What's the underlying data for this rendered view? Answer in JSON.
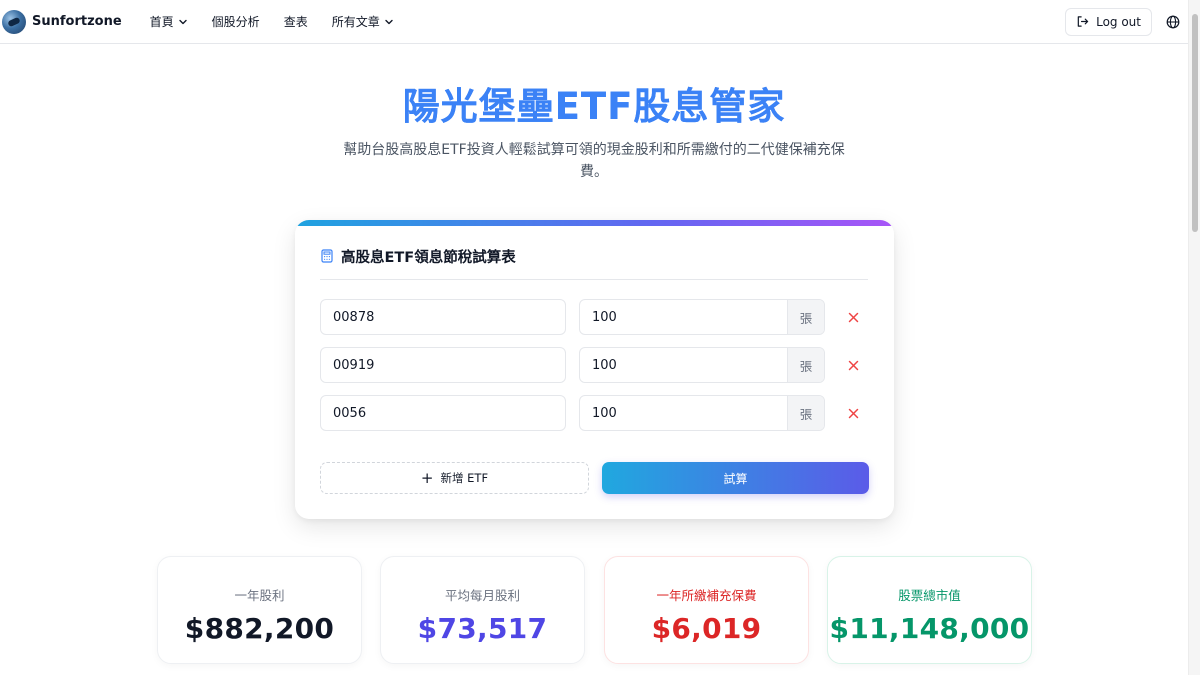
{
  "nav": {
    "brand": "Sunfortzone",
    "items": [
      {
        "label": "首頁",
        "has_dropdown": true
      },
      {
        "label": "個股分析",
        "has_dropdown": false
      },
      {
        "label": "查表",
        "has_dropdown": false
      },
      {
        "label": "所有文章",
        "has_dropdown": true
      }
    ],
    "logout_label": "Log out"
  },
  "hero": {
    "title": "陽光堡壘ETF股息管家",
    "subtitle": "幫助台股高股息ETF投資人輕鬆試算可領的現金股利和所需繳付的二代健保補充保費。"
  },
  "calculator": {
    "title": "高股息ETF領息節稅試算表",
    "unit": "張",
    "rows": [
      {
        "code": "00878",
        "quantity": "100"
      },
      {
        "code": "00919",
        "quantity": "100"
      },
      {
        "code": "0056",
        "quantity": "100"
      }
    ],
    "add_label": "新增 ETF",
    "calc_label": "試算"
  },
  "stats": [
    {
      "label": "一年股利",
      "value": "$882,200",
      "color": "#111827",
      "label_color": "#6b7280"
    },
    {
      "label": "平均每月股利",
      "value": "$73,517",
      "color": "#4f46e5",
      "label_color": "#6b7280"
    },
    {
      "label": "一年所繳補充保費",
      "value": "$6,019",
      "color": "#dc2626",
      "label_color": "#dc2626"
    },
    {
      "label": "股票總市值",
      "value": "$11,148,000",
      "color": "#059669",
      "label_color": "#059669"
    }
  ],
  "colors": {
    "accent_blue": "#3b82f6",
    "remove_red": "#ef4444"
  },
  "icons": {
    "logo": "sunfortzone-logo",
    "logout": "logout-icon",
    "language": "globe-icon",
    "calculator": "calculator-icon",
    "remove": "close-icon",
    "add": "plus-icon"
  }
}
